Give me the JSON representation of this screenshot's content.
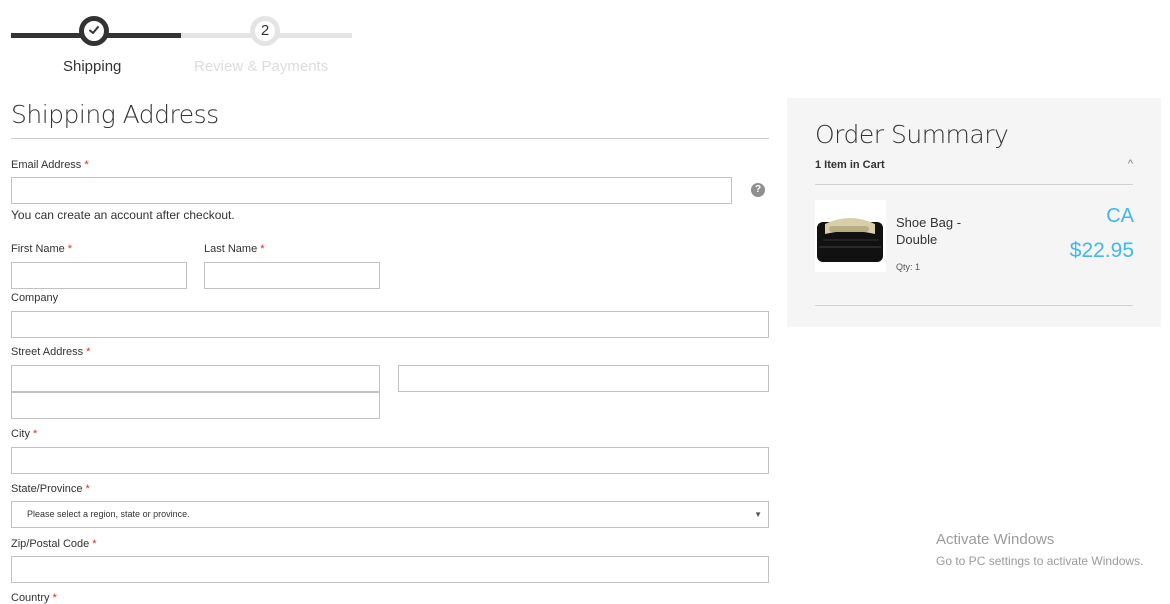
{
  "progress": {
    "step1_label": "Shipping",
    "step2_number": "2",
    "step2_label": "Review & Payments"
  },
  "form": {
    "title": "Shipping Address",
    "email_label": "Email Address",
    "email_value": "",
    "account_note": "You can create an account after checkout.",
    "first_name_label": "First Name",
    "first_name_value": "",
    "last_name_label": "Last Name",
    "last_name_value": "",
    "company_label": "Company",
    "company_value": "",
    "street_label": "Street Address",
    "street_line1_value": "",
    "street_line2_value": "",
    "street_line3_value": "",
    "city_label": "City",
    "city_value": "",
    "state_label": "State/Province",
    "state_selected": "Please select a region, state or province.",
    "zip_label": "Zip/Postal Code",
    "zip_value": "",
    "country_label": "Country",
    "required_mark": "*",
    "help_icon": "?"
  },
  "summary": {
    "title": "Order Summary",
    "items_in_cart": "1 Item in Cart",
    "caret": "^",
    "product_name": "Shoe Bag - Double",
    "qty": "Qty: 1",
    "currency": "CA",
    "price": "$22.95"
  },
  "watermark": {
    "title": "Activate Windows",
    "subtitle": "Go to PC settings to activate Windows."
  },
  "colors": {
    "accent_price": "#41b8e8",
    "required": "#e02b27",
    "progress_done": "#333333",
    "progress_todo": "#e4e4e4",
    "summary_bg": "#f5f5f5"
  }
}
